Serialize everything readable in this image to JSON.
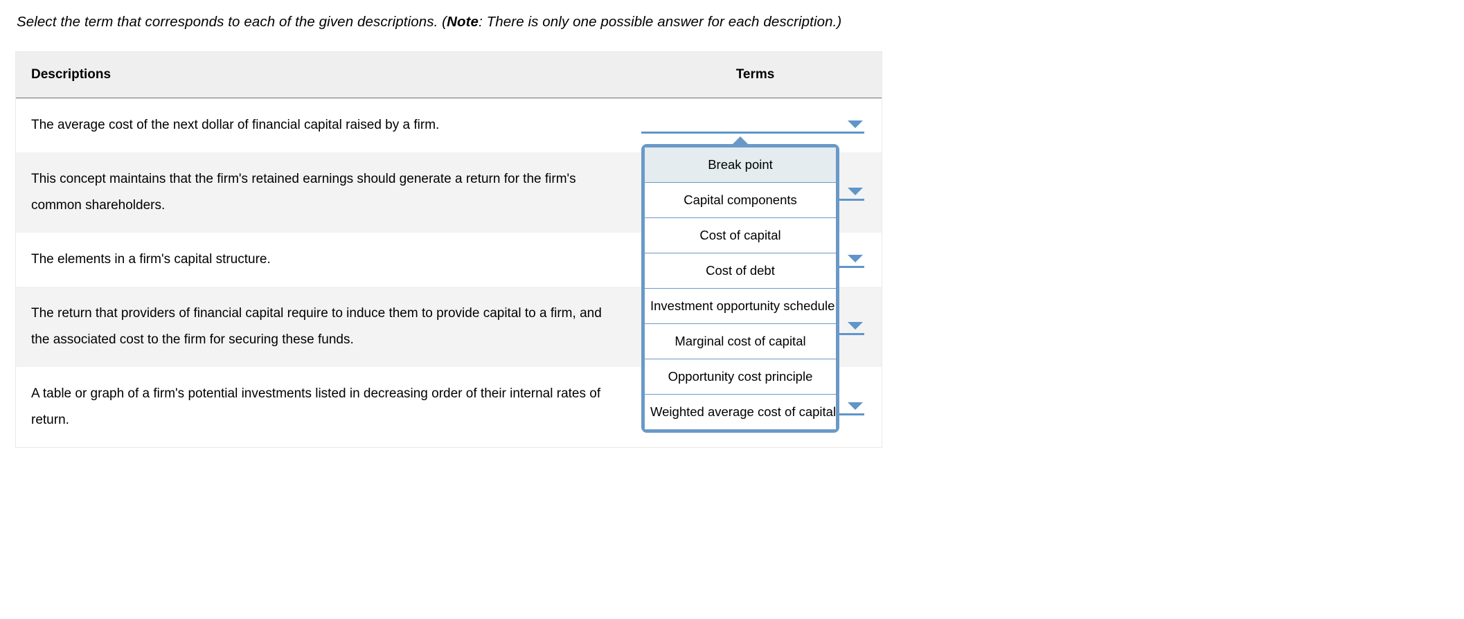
{
  "instruction": {
    "prefix": "Select the term that corresponds to each of the given descriptions. (",
    "note_label": "Note",
    "suffix": ": There is only one possible answer for each description.)"
  },
  "headers": {
    "descriptions": "Descriptions",
    "terms": "Terms"
  },
  "rows": [
    {
      "description": "The average cost of the next dollar of financial capital raised by a firm."
    },
    {
      "description": "This concept maintains that the firm's retained earnings should generate a return for the firm's common shareholders."
    },
    {
      "description": "The elements in a firm's capital structure."
    },
    {
      "description": "The return that providers of financial capital require to induce them to provide capital to a firm, and the associated cost to the firm for securing these funds."
    },
    {
      "description": "A table or graph of a firm's potential investments listed in decreasing order of their internal rates of return."
    }
  ],
  "dropdown": {
    "options": [
      "Break point",
      "Capital components",
      "Cost of capital",
      "Cost of debt",
      "Investment opportunity schedule",
      "Marginal cost of capital",
      "Opportunity cost principle",
      "Weighted average cost of capital"
    ],
    "highlighted_index": 0
  }
}
